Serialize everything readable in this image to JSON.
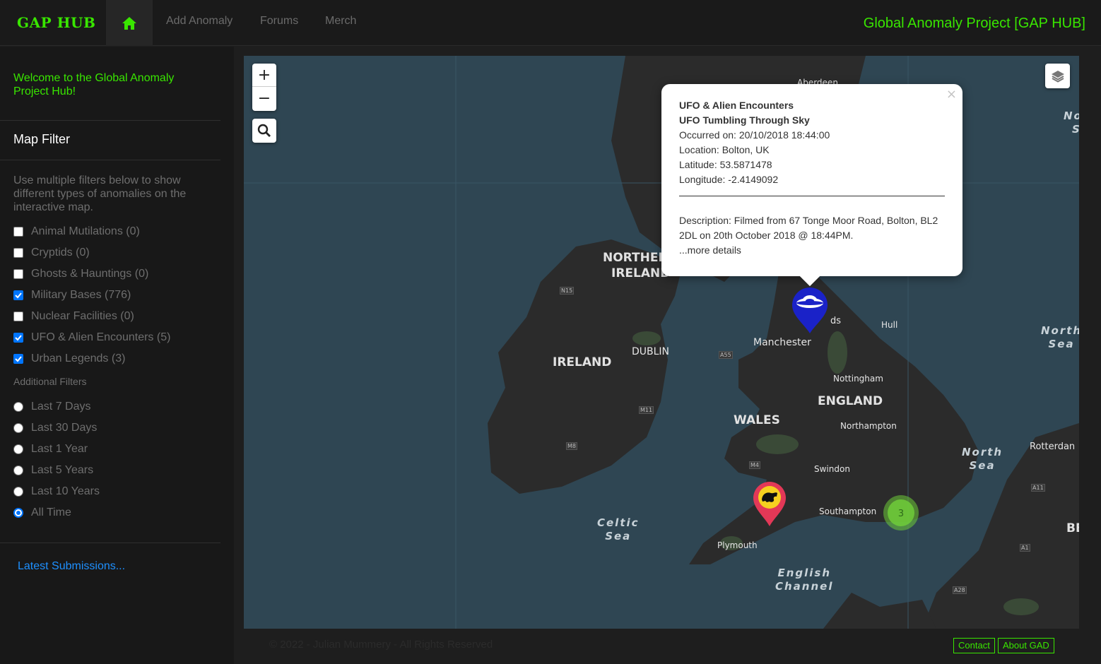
{
  "nav": {
    "brand": "GAP HUB",
    "home_icon": "home-icon",
    "links": [
      "Add Anomaly",
      "Forums",
      "Merch"
    ],
    "site_title": "Global Anomaly Project [GAP HUB]",
    "accent": "#39e600"
  },
  "sidebar": {
    "welcome": "Welcome to the Global Anomaly Project Hub!",
    "filter_title": "Map Filter",
    "filter_desc": "Use multiple filters below to show different types of anomalies on the interactive map.",
    "checkboxes": [
      {
        "label": "Animal Mutilations (0)",
        "checked": false
      },
      {
        "label": "Cryptids (0)",
        "checked": false
      },
      {
        "label": "Ghosts & Hauntings (0)",
        "checked": false
      },
      {
        "label": "Military Bases (776)",
        "checked": true
      },
      {
        "label": "Nuclear Facilities (0)",
        "checked": false
      },
      {
        "label": "UFO & Alien Encounters (5)",
        "checked": true
      },
      {
        "label": "Urban Legends (3)",
        "checked": true
      }
    ],
    "additional_title": "Additional Filters",
    "radios": [
      {
        "label": "Last 7 Days",
        "checked": false
      },
      {
        "label": "Last 30 Days",
        "checked": false
      },
      {
        "label": "Last 1 Year",
        "checked": false
      },
      {
        "label": "Last 5 Years",
        "checked": false
      },
      {
        "label": "Last 10 Years",
        "checked": false
      },
      {
        "label": "All Time",
        "checked": true
      }
    ],
    "latest_link": "Latest Submissions..."
  },
  "map": {
    "zoom_in": "+",
    "zoom_out": "−",
    "search_icon": "search-icon",
    "layers_icon": "layers-icon",
    "labels": {
      "aberdeen": "Aberdeen",
      "northern_ireland_1": "NORTHER",
      "northern_ireland_2": "IRELAND",
      "ireland": "IRELAND",
      "dublin": "DUBLIN",
      "manchester": "Manchester",
      "leeds": "ds",
      "hull": "Hull",
      "nottingham": "Nottingham",
      "england": "ENGLAND",
      "wales": "WALES",
      "northampton": "Northampton",
      "swindon": "Swindon",
      "southampton": "Southampton",
      "plymouth": "Plymouth",
      "rotterdam": "Rotterdan",
      "be": "BE",
      "north_sea_top_1": "No",
      "north_sea_top_2": "S",
      "north_sea_mid_1": "North",
      "north_sea_mid_2": "Sea",
      "north_sea_low_1": "North",
      "north_sea_low_2": "Sea",
      "celtic_1": "Celtic",
      "celtic_2": "Sea",
      "channel_1": "English",
      "channel_2": "Channel",
      "road_n15": "N15",
      "road_a55": "A55",
      "road_m11": "M11",
      "road_m8": "M8",
      "road_m4": "M4",
      "road_a11": "A11",
      "road_a1": "A1",
      "road_a28": "A28"
    },
    "ufo_marker_icon": "ufo-marker-icon",
    "legend_marker_icon": "urban-legend-marker-icon",
    "cluster_count": "3",
    "popup": {
      "category": "UFO & Alien Encounters",
      "title": "UFO Tumbling Through Sky",
      "occurred": "Occurred on: 20/10/2018 18:44:00",
      "location": "Location: Bolton, UK",
      "latitude": "Latitude: 53.5871478",
      "longitude": "Longitude: -2.4149092",
      "description": "Description: Filmed from 67 Tonge Moor Road, Bolton, BL2 2DL on 20th October 2018 @ 18:44PM.",
      "more": "...more details",
      "close": "×"
    }
  },
  "footer": {
    "copyright": "© 2022 - Julian Mummery - All Rights Reserved",
    "contact": "Contact",
    "about": "About GAD"
  }
}
